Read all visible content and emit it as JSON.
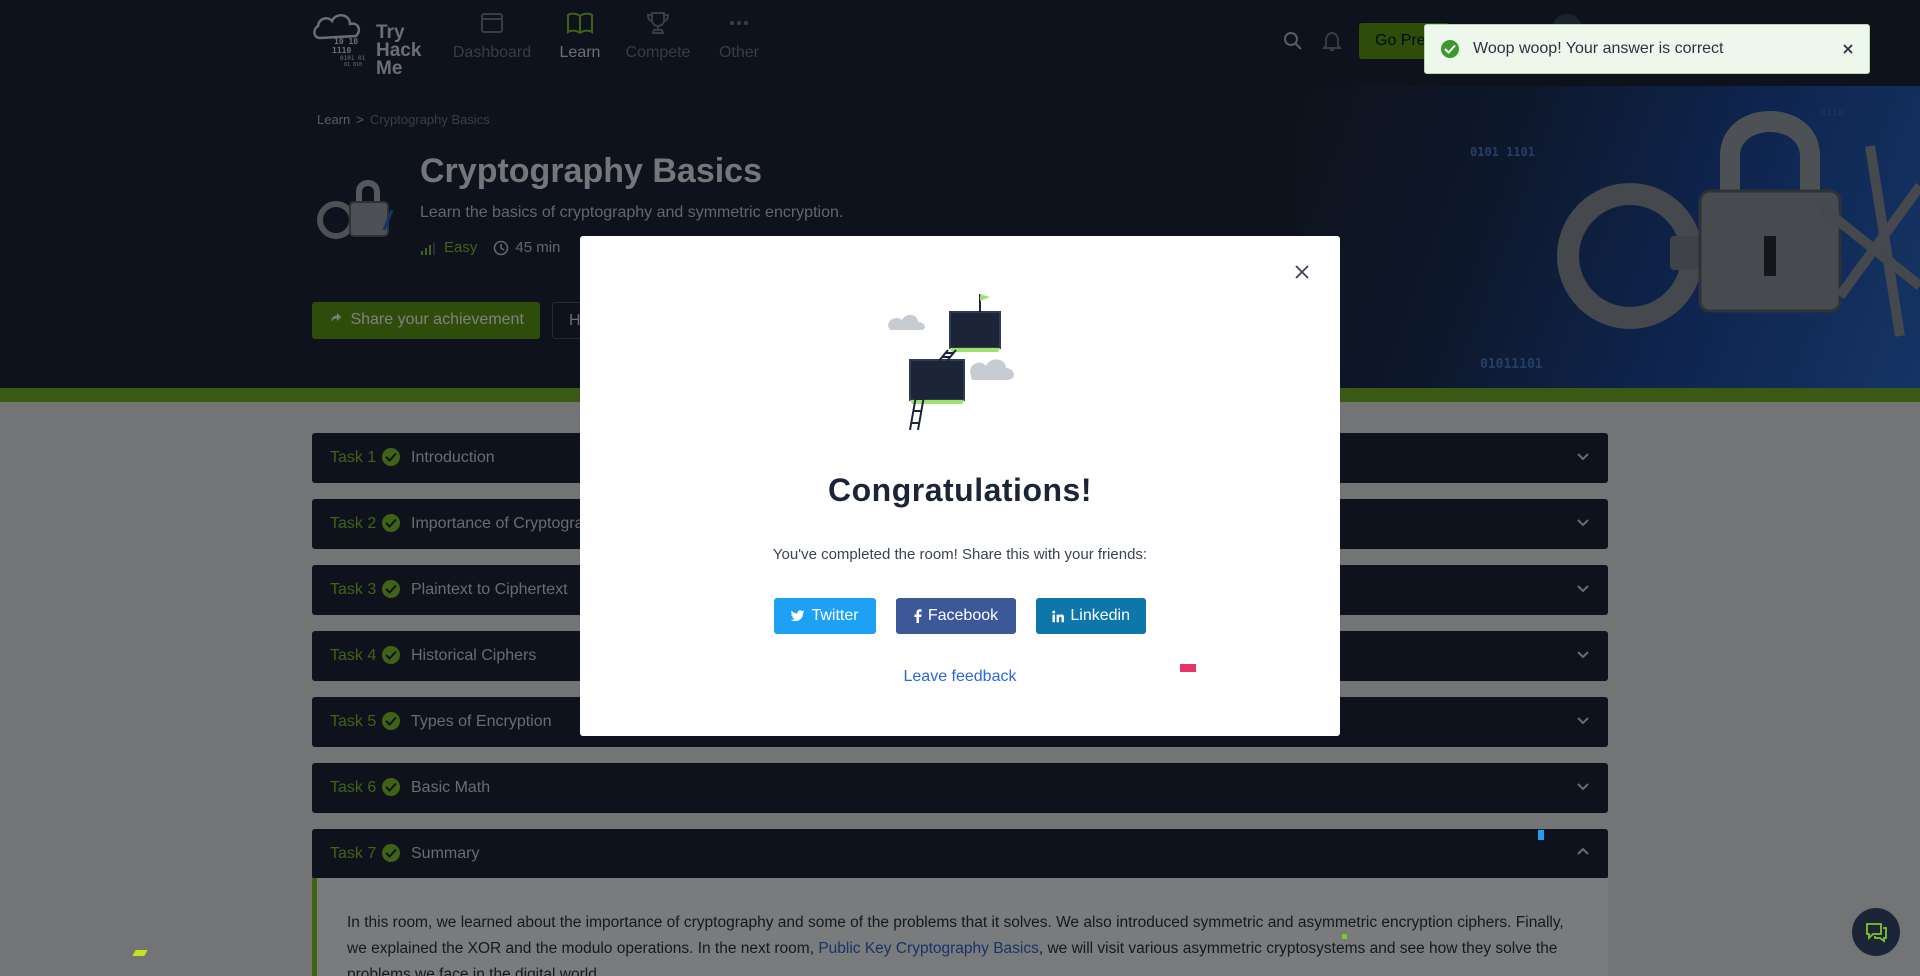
{
  "nav": {
    "brand_line1": "Try",
    "brand_line2": "Hack",
    "brand_line3": "Me",
    "items": [
      {
        "label": "Dashboard",
        "icon": "dashboard-icon"
      },
      {
        "label": "Learn",
        "icon": "book-icon"
      },
      {
        "label": "Compete",
        "icon": "trophy-icon"
      },
      {
        "label": "Other",
        "icon": "dots-icon"
      }
    ],
    "active": "Learn",
    "premium_label": "Go Premium"
  },
  "breadcrumb": {
    "root": "Learn",
    "sep": ">",
    "current": "Cryptography Basics"
  },
  "room": {
    "title": "Cryptography Basics",
    "description": "Learn the basics of cryptography and symmetric encryption.",
    "difficulty": "Easy",
    "duration": "45 min",
    "share_label": "Share your achievement",
    "help_label": "Help"
  },
  "tasks": [
    {
      "num": "Task 1",
      "name": "Introduction"
    },
    {
      "num": "Task 2",
      "name": "Importance of Cryptography"
    },
    {
      "num": "Task 3",
      "name": "Plaintext to Ciphertext"
    },
    {
      "num": "Task 4",
      "name": "Historical Ciphers"
    },
    {
      "num": "Task 5",
      "name": "Types of Encryption"
    },
    {
      "num": "Task 6",
      "name": "Basic Math"
    },
    {
      "num": "Task 7",
      "name": "Summary"
    }
  ],
  "summary": {
    "text1": "In this room, we learned about the importance of cryptography and some of the problems that it solves. We also introduced symmetric and asymmetric encryption ciphers. Finally, we explained the XOR and the modulo operations. In the next room, ",
    "link": "Public Key Cryptography Basics",
    "text2": ", we will visit various asymmetric cryptosystems and see how they solve the problems we face in the digital world."
  },
  "modal": {
    "title": "Congratulations!",
    "text": "You've completed the room! Share this with your friends:",
    "twitter": "Twitter",
    "facebook": "Facebook",
    "linkedin": "Linkedin",
    "feedback": "Leave feedback"
  },
  "toast": {
    "message": "Woop woop! Your answer is correct"
  },
  "colors": {
    "navy": "#1c2538",
    "green": "#7fc52b",
    "twitter": "#1da1f2",
    "facebook": "#3b5998",
    "linkedin": "#0e76a8"
  }
}
